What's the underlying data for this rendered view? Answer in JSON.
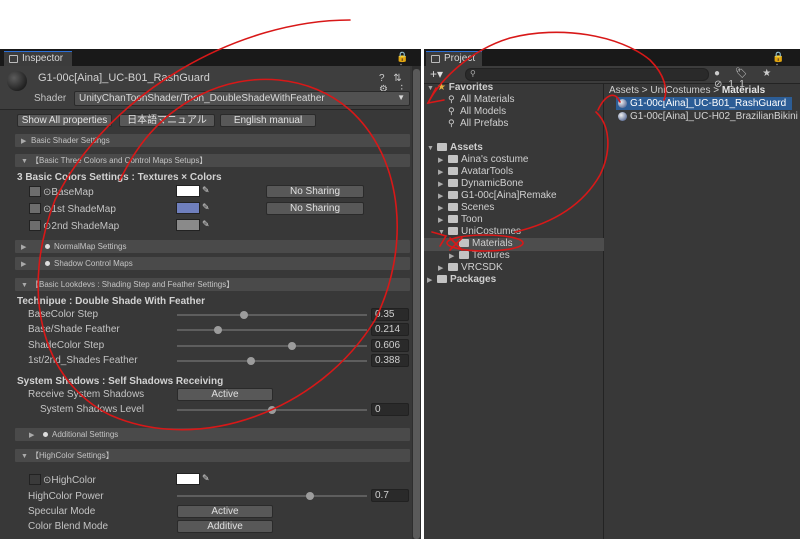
{
  "inspector": {
    "tab_label": "Inspector",
    "tab_tools": "🔒 ⋮",
    "material_name": "G1-00c[Aina]_UC-B01_RashGuard",
    "header_tools": "? ⇅ ⚙ ⋮",
    "shader_label": "Shader",
    "shader_value": "UnityChanToonShader/Toon_DoubleShadeWithFeather",
    "buttons": {
      "show_all": "Show All properties",
      "japanese_manual": "日本語マニュアル",
      "english_manual": "English manual"
    },
    "foldouts": {
      "basic_shader": "Basic Shader Settings",
      "three_colors": "【Basic Three Colors and Control Maps Setups】",
      "normalmap": "NormalMap Settings",
      "shadow_control": "Shadow Control Maps",
      "basic_lookdevs": "【Basic Lookdevs : Shading Step and Feather Settings】",
      "additional": "Additional Settings",
      "highcolor": "【HighColor Settings】"
    },
    "three_colors_title": "3 Basic Colors Settings : Textures × Colors",
    "basemap_label": "BaseMap",
    "shademap1_label": "1st ShadeMap",
    "shademap2_label": "2nd ShadeMap",
    "no_sharing_1": "No Sharing",
    "no_sharing_2": "No Sharing",
    "colors": {
      "base": "#ffffff",
      "shade1": "#6f7fbd",
      "shade2": "#8a8a8a",
      "highcolor": "#ffffff"
    },
    "technique_title": "Technipue : Double Shade With Feather",
    "sliders": [
      {
        "label": "BaseColor Step",
        "value": "0.35",
        "fraction": 0.35
      },
      {
        "label": "Base/Shade Feather",
        "value": "0.214",
        "fraction": 0.214
      },
      {
        "label": "ShadeColor Step",
        "value": "0.606",
        "fraction": 0.606
      },
      {
        "label": "1st/2nd_Shades Feather",
        "value": "0.388",
        "fraction": 0.388
      }
    ],
    "system_shadows_title": "System Shadows : Self Shadows Receiving",
    "receive_label": "Receive System Shadows",
    "receive_value": "Active",
    "shadows_level_label": "System Shadows Level",
    "shadows_level_value": "0",
    "shadows_level_fraction": 0.5,
    "highcolor_label": "HighColor",
    "highcolor_power_label": "HighColor Power",
    "highcolor_power_value": "0.7",
    "highcolor_power_fraction": 0.7,
    "specular_label": "Specular Mode",
    "specular_value": "Active",
    "blend_label": "Color Blend Mode",
    "blend_value": "Additive"
  },
  "project": {
    "tab_label": "Project",
    "tab_tools": "🔒 ⋮",
    "toolbar_plus": "+▾",
    "toolbar_icons": "● 🏷 ★ ⊘11",
    "favorites_label": "Favorites",
    "favorites": [
      "All Materials",
      "All Models",
      "All Prefabs"
    ],
    "assets_label": "Assets",
    "asset_folders": [
      "Aina's costume",
      "AvatarTools",
      "DynamicBone",
      "G1-00c[Aina]Remake",
      "Scenes",
      "Toon",
      "UniCostumes"
    ],
    "unicostumes_children": [
      "Materials",
      "Textures"
    ],
    "vrcsdk": "VRCSDK",
    "packages": "Packages",
    "breadcrumb": {
      "root": "Assets",
      "mid": "UniCostumes",
      "current": "Materials",
      "sep": ">"
    },
    "files": [
      "G1-00c[Aina]_UC-B01_RashGuard",
      "G1-00c[Aina]_UC-H02_BrazilianBikini"
    ]
  }
}
